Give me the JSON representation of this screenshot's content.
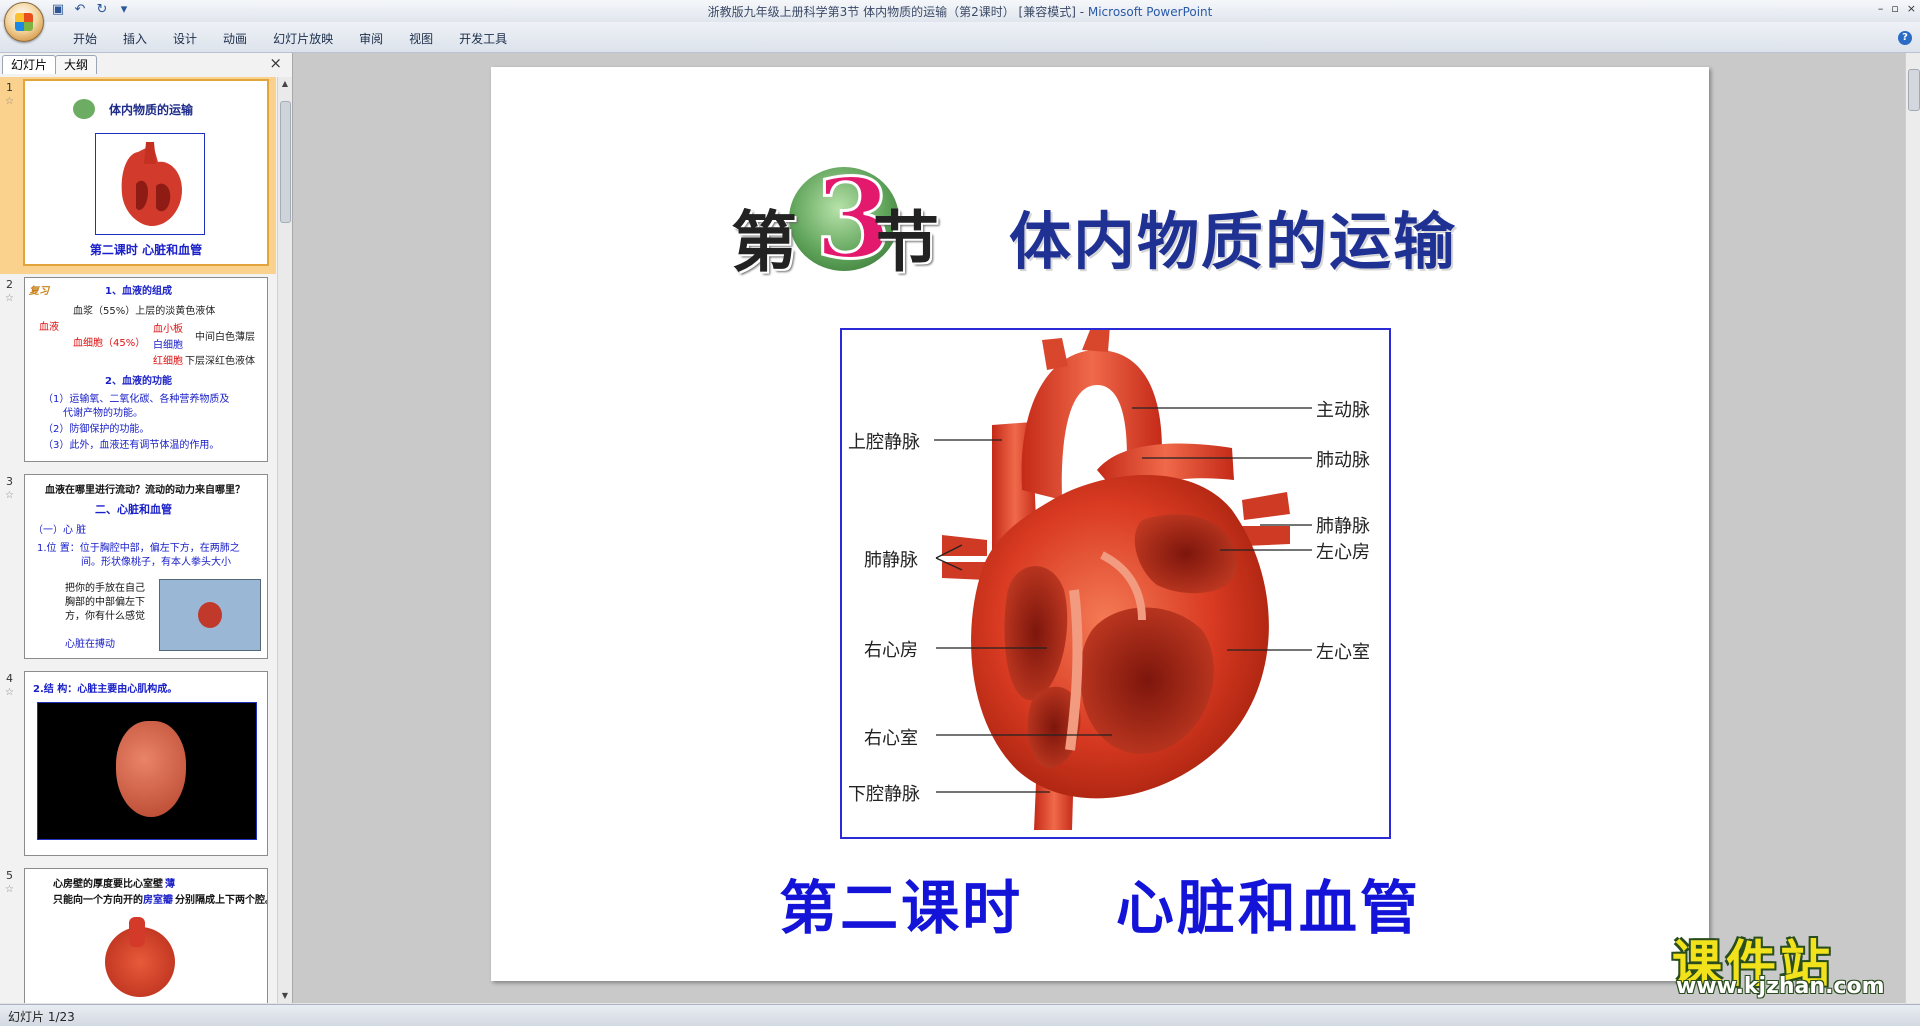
{
  "window": {
    "title_doc": "浙教版九年级上册科学第3节 体内物质的运输（第2课时） [兼容模式] - ",
    "title_app": "Microsoft PowerPoint",
    "controls": {
      "minimize": "–",
      "restore": "▫",
      "close": "×"
    }
  },
  "qat": {
    "save_icon": "save-icon",
    "undo_icon": "undo-icon",
    "redo_icon": "redo-icon",
    "more": "▾"
  },
  "ribbon": {
    "tabs": [
      "开始",
      "插入",
      "设计",
      "动画",
      "幻灯片放映",
      "审阅",
      "视图",
      "开发工具"
    ],
    "help": "?"
  },
  "left_panel": {
    "tabs": [
      "幻灯片",
      "大纲"
    ],
    "close": "×",
    "slides": [
      {
        "number": "1",
        "title": "体内物质的运输",
        "subtitle": "第二课时   心脏和血管"
      },
      {
        "number": "2",
        "lines": [
          "复习",
          "1、血液的组成",
          "血浆（55%）上层的淡黄色液体",
          "血液",
          "血细胞（45%）",
          "血小板",
          "白细胞",
          "中间白色薄层",
          "红细胞",
          "下层深红色液体",
          "2、血液的功能",
          "（1）运输氧、二氧化碳、各种营养物质及",
          "代谢产物的功能。",
          "（2）防御保护的功能。",
          "（3）此外，血液还有调节体温的作用。"
        ]
      },
      {
        "number": "3",
        "lines": [
          "血液在哪里进行流动？流动的动力来自哪里？",
          "二、心脏和血管",
          "（一）心 脏",
          "1.位 置：位于胸腔中部，偏左下方，在两肺之",
          "间。形状像桃子，有本人拳头大小",
          "把你的手放在自己",
          "胸部的中部偏左下",
          "方，你有什么感觉",
          "心脏在搏动"
        ]
      },
      {
        "number": "4",
        "lines": [
          "2.结 构：心脏主要由心肌构成。"
        ]
      },
      {
        "number": "5",
        "lines": [
          "心房壁的厚度要比心室壁",
          "薄",
          "只能向一个方向开的",
          "房室瓣",
          "分别隔成上下两个腔。"
        ]
      }
    ]
  },
  "slide": {
    "banner": {
      "prefix": "第",
      "number": "3",
      "suffix": "节",
      "title": "体内物质的运输"
    },
    "heart_labels": {
      "svc": "上腔静脉",
      "aorta": "主动脉",
      "pulm_artery": "肺动脉",
      "pulm_vein_right": "肺静脉",
      "left_atrium": "左心房",
      "pulm_vein_left": "肺静脉",
      "right_atrium": "右心房",
      "left_ventricle": "左心室",
      "right_ventricle": "右心室",
      "ivc": "下腔静脉"
    },
    "subtitle": "第二课时    心脏和血管"
  },
  "status": {
    "slide_indicator": "幻灯片 1/23"
  },
  "watermark": {
    "name": "课件站",
    "url": "www.kjzhan.com"
  },
  "colors": {
    "banner_title": "#1f3294",
    "banner_number": "#e3196e",
    "subtitle": "#1414d8",
    "frame_border": "#2a2ad6",
    "selected_thumb": "#fbd28d"
  }
}
